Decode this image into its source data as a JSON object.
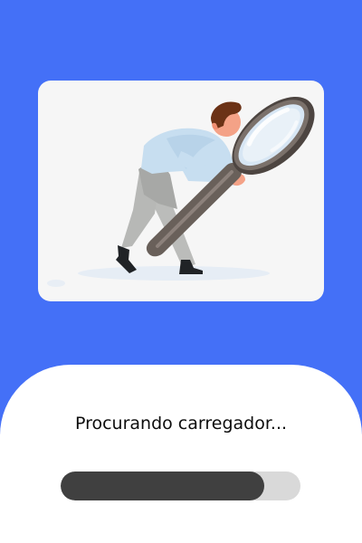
{
  "theme": {
    "background": "#4470F7",
    "card_background": "#F6F6F6",
    "sheet_background": "#FFFFFF",
    "progress_track": "#D9D9D9",
    "progress_fill": "#404040",
    "text": "#0D0D0D"
  },
  "illustration": {
    "name": "man-with-magnifying-glass-illustration",
    "icon": "magnifying-glass-icon"
  },
  "loading": {
    "status_text": "Procurando carregador...",
    "progress": 0.85
  }
}
